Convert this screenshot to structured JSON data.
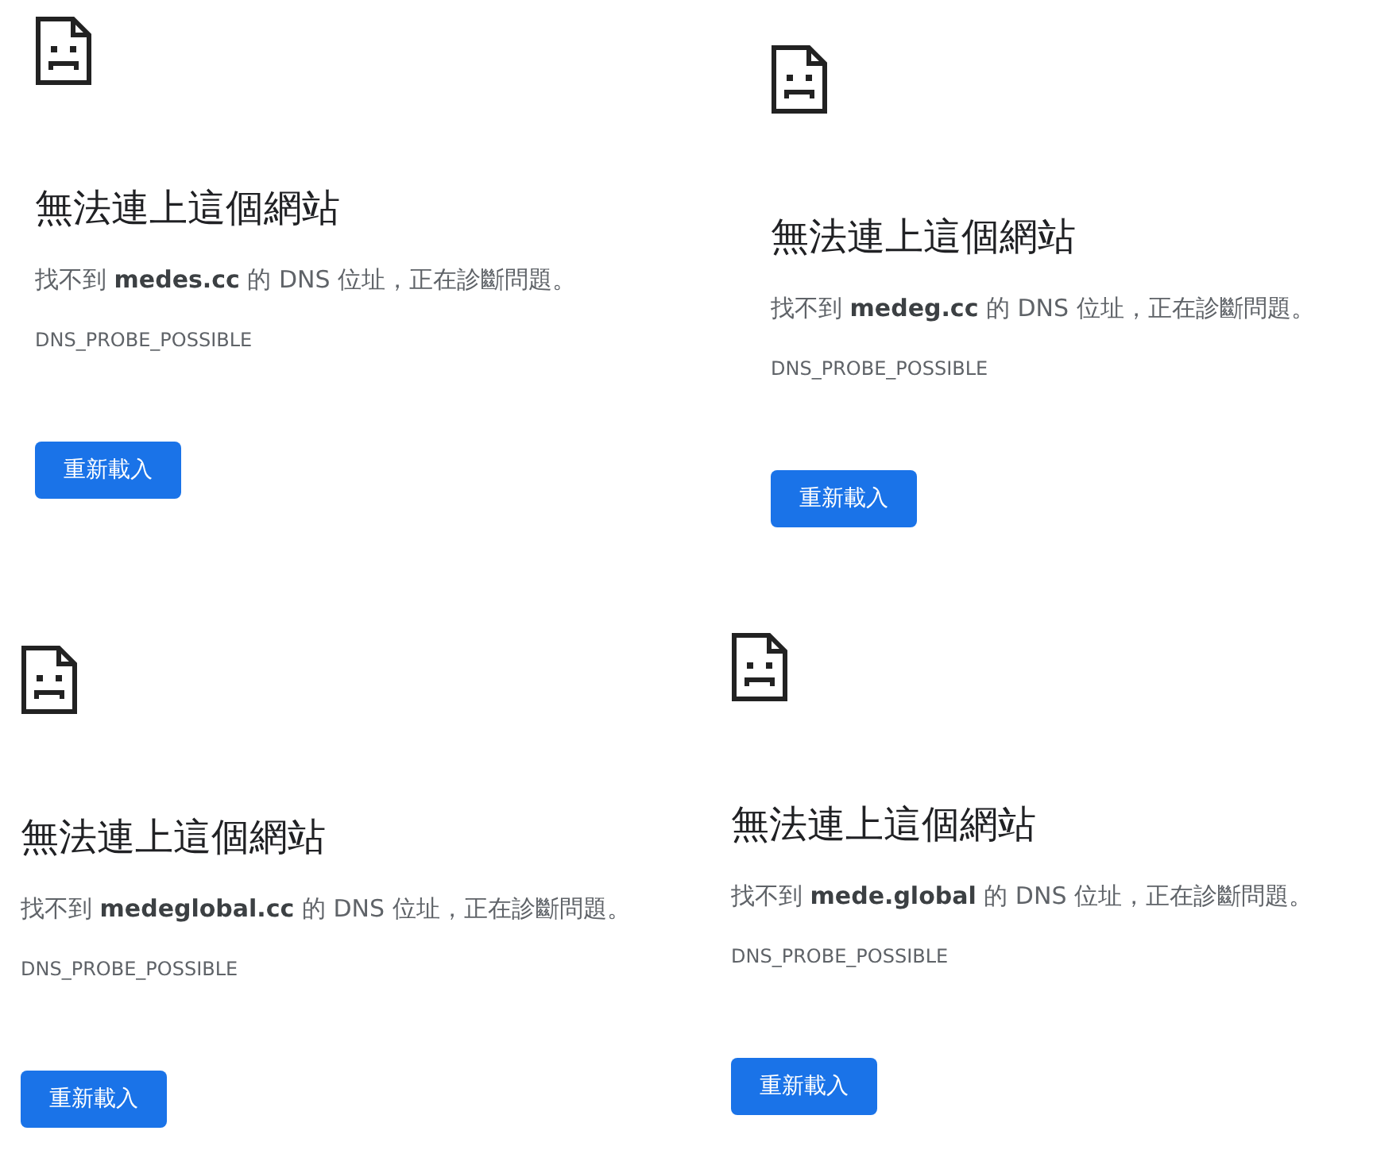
{
  "panels": [
    {
      "title": "無法連上這個網站",
      "message": "找不到 **medes.cc** 的 DNS 位址，正在診斷問題。",
      "error_code": "DNS_PROBE_POSSIBLE",
      "button": "重新載入"
    },
    {
      "title": "無法連上這個網站",
      "message": "找不到 **medeg.cc** 的 DNS 位址，正在診斷問題。",
      "error_code": "DNS_PROBE_POSSIBLE",
      "button": "重新載入"
    },
    {
      "title": "無法連上這個網站",
      "message": "找不到 **medeglobal.cc** 的 DNS 位址，正在診斷問題。",
      "error_code": "DNS_PROBE_POSSIBLE",
      "button": "重新載入"
    },
    {
      "title": "無法連上這個網站",
      "message": "找不到 **mede.global** 的 DNS 位址，正在診斷問題。",
      "error_code": "DNS_PROBE_POSSIBLE",
      "button": "重新載入"
    }
  ]
}
